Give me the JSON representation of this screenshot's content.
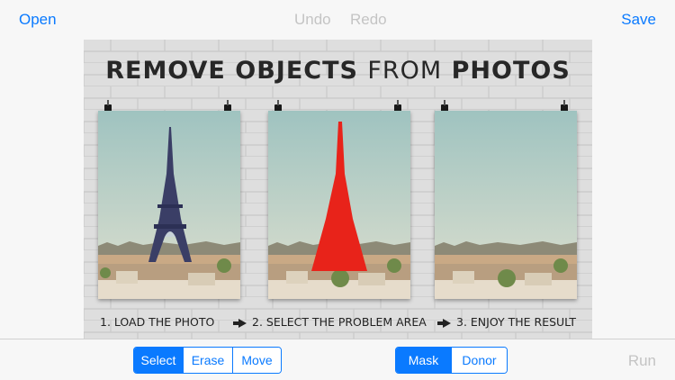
{
  "toolbar": {
    "open_label": "Open",
    "undo_label": "Undo",
    "redo_label": "Redo",
    "save_label": "Save"
  },
  "canvas": {
    "title_bold_1": "REMOVE OBJECTS",
    "title_light": "FROM",
    "title_bold_2": "PHOTOS",
    "steps": [
      "1. LOAD THE PHOTO",
      "2. SELECT THE PROBLEM AREA",
      "3. ENJOY THE RESULT"
    ]
  },
  "bottom": {
    "tool_segments": [
      "Select",
      "Erase",
      "Move"
    ],
    "tool_selected": "Select",
    "view_segments": [
      "Mask",
      "Donor"
    ],
    "view_selected": "Mask",
    "run_label": "Run"
  },
  "colors": {
    "accent": "#0a7aff",
    "disabled": "#c4c4c4",
    "mask_red": "#e8231a"
  }
}
